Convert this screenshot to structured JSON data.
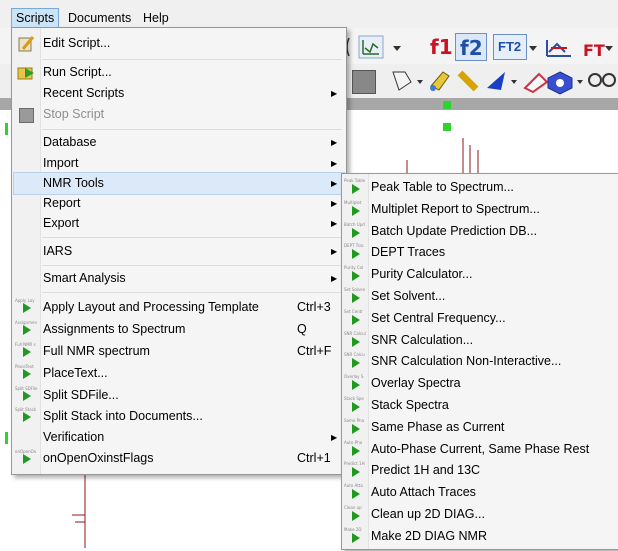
{
  "menubar": [
    "Scripts",
    "Documents",
    "Help"
  ],
  "toolbar": {
    "f1": "f1",
    "f2": "f2",
    "ft2": "FT2",
    "ft": "FT"
  },
  "main_menu": {
    "items": [
      {
        "label": "Edit Script...",
        "icon": "edit-script-icon"
      },
      {
        "label": "Run Script...",
        "icon": "run-script-icon"
      },
      {
        "label": "Recent Scripts",
        "submenu": true
      },
      {
        "label": "Stop Script",
        "disabled": true,
        "icon": "stop-icon"
      },
      {
        "label": "Database",
        "submenu": true
      },
      {
        "label": "Import",
        "submenu": true
      },
      {
        "label": "NMR Tools",
        "submenu": true,
        "highlighted": true
      },
      {
        "label": "Report",
        "submenu": true
      },
      {
        "label": "Export",
        "submenu": true
      },
      {
        "label": "IARS",
        "submenu": true
      },
      {
        "label": "Smart Analysis",
        "submenu": true
      },
      {
        "label": "Apply Layout and Processing Template",
        "shortcut": "Ctrl+3",
        "icon": "play-icon",
        "tag": "Apply Lay"
      },
      {
        "label": "Assignments to Spectrum",
        "shortcut": "Q",
        "icon": "play-icon",
        "tag": "Assignmen"
      },
      {
        "label": "Full NMR spectrum",
        "shortcut": "Ctrl+F",
        "icon": "play-icon",
        "tag": "Full NMR s"
      },
      {
        "label": "PlaceText...",
        "icon": "play-icon",
        "tag": "PlaceText"
      },
      {
        "label": "Split SDFile...",
        "icon": "play-icon",
        "tag": "Split SDFile"
      },
      {
        "label": "Split Stack into Documents...",
        "icon": "play-icon",
        "tag": "Split Stack"
      },
      {
        "label": "Verification",
        "submenu": true
      },
      {
        "label": "onOpenOxinstFlags",
        "shortcut": "Ctrl+1",
        "icon": "play-icon",
        "tag": "onOpenOx"
      }
    ]
  },
  "nmr_tools_submenu": [
    {
      "label": "Peak Table to Spectrum...",
      "tag": "Peak Table"
    },
    {
      "label": "Multiplet Report to Spectrum...",
      "tag": "Multiplet"
    },
    {
      "label": "Batch Update Prediction DB...",
      "tag": "Batch Upd"
    },
    {
      "label": "DEPT Traces",
      "tag": "DEPT Trac"
    },
    {
      "label": "Purity Calculator...",
      "tag": "Purity Cal"
    },
    {
      "label": "Set Solvent...",
      "tag": "Set Solven"
    },
    {
      "label": "Set Central Frequency...",
      "tag": "Set Centr"
    },
    {
      "label": "SNR Calculation...",
      "tag": "SNR Calcul"
    },
    {
      "label": "SNR Calculation Non-Interactive...",
      "tag": "SNR Calcu"
    },
    {
      "label": "Overlay Spectra",
      "tag": "Overlay S"
    },
    {
      "label": "Stack Spectra",
      "tag": "Stack Spe"
    },
    {
      "label": "Same Phase as Current",
      "tag": "Same Pha"
    },
    {
      "label": "Auto-Phase Current, Same Phase Rest",
      "tag": "Auto-Pha"
    },
    {
      "label": "Predict 1H and 13C",
      "tag": "Predict 1H"
    },
    {
      "label": "Auto Attach Traces",
      "tag": "Auto Atta"
    },
    {
      "label": "Clean up 2D DIAG...",
      "tag": "Clean up"
    },
    {
      "label": "Make 2D DIAG NMR",
      "tag": "Make 2D"
    }
  ],
  "colors": {
    "accent_green": "#1f9a1f",
    "menu_highlight": "#dce9f8",
    "toolbar_red": "#cc1122"
  }
}
